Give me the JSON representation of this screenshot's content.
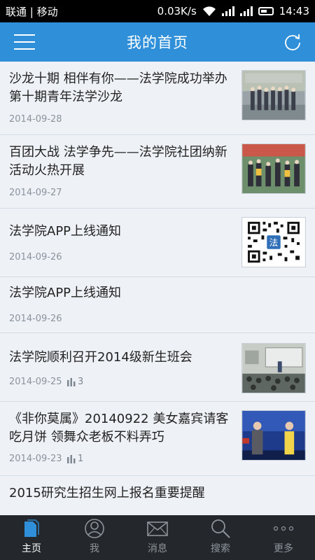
{
  "status_bar": {
    "carrier": "联通 | 移动",
    "speed": "0.03K/s",
    "time": "14:43"
  },
  "header": {
    "title": "我的首页",
    "menu_icon": "hamburger-menu-icon",
    "refresh_icon": "refresh-icon"
  },
  "news": [
    {
      "title": "沙龙十期 相伴有你——法学院成功举办第十期青年法学沙龙",
      "date": "2014-09-28",
      "views": "",
      "thumb": "group-photo"
    },
    {
      "title": "百团大战 法学争先——法学院社团纳新活动火热开展",
      "date": "2014-09-27",
      "views": "",
      "thumb": "outdoor-crowd"
    },
    {
      "title": "法学院APP上线通知",
      "date": "2014-09-26",
      "views": "",
      "thumb": "qr-code"
    },
    {
      "title": "法学院APP上线通知",
      "date": "2014-09-26",
      "views": "",
      "thumb": ""
    },
    {
      "title": "法学院顺利召开2014级新生班会",
      "date": "2014-09-25",
      "views": "3",
      "thumb": "classroom"
    },
    {
      "title": "《非你莫属》20140922 美女嘉宾请客吃月饼 领舞众老板不料弄巧",
      "date": "2014-09-23",
      "views": "1",
      "thumb": "tv-stage"
    },
    {
      "title": "2015研究生招生网上报名重要提醒",
      "date": "",
      "views": "",
      "thumb": ""
    }
  ],
  "tabs": [
    {
      "label": "主页",
      "icon": "home-document-icon",
      "active": true
    },
    {
      "label": "我",
      "icon": "user-icon",
      "active": false
    },
    {
      "label": "消息",
      "icon": "mail-icon",
      "active": false
    },
    {
      "label": "搜索",
      "icon": "search-icon",
      "active": false
    },
    {
      "label": "更多",
      "icon": "more-dots-icon",
      "active": false
    }
  ],
  "colors": {
    "accent": "#2f8fd8",
    "tabbar_bg": "#24282c"
  }
}
